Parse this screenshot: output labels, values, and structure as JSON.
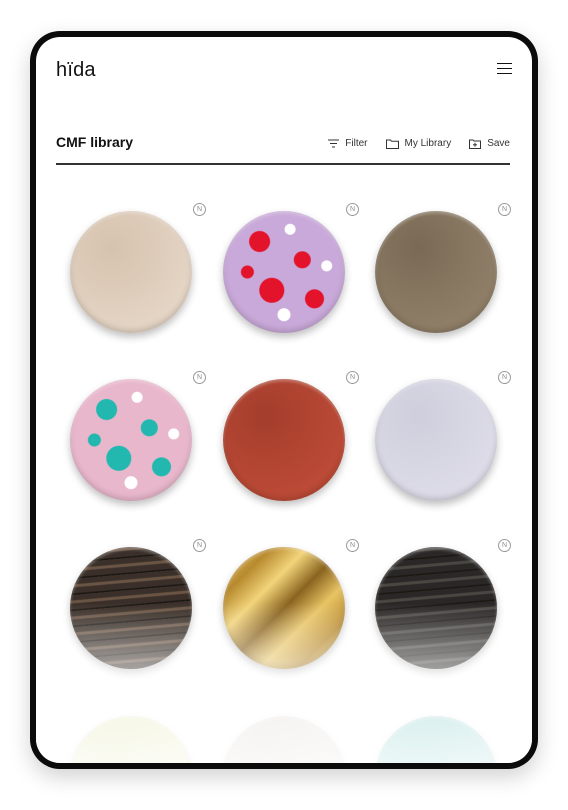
{
  "header": {
    "logo": "hïda"
  },
  "page": {
    "title": "CMF library"
  },
  "toolbar": {
    "filter_label": "Filter",
    "library_label": "My Library",
    "save_label": "Save"
  },
  "badge_glyph": "N",
  "materials": [
    {
      "name": "beige-textured",
      "color": "#e4d4c4",
      "color2": "#d6c2ae",
      "pattern": "plain"
    },
    {
      "name": "lilac-red-terrazzo",
      "color": "#c9a9d9",
      "color2": "#e4132c",
      "pattern": "terrazzo"
    },
    {
      "name": "taupe-matte",
      "color": "#8f7e67",
      "color2": "#7a6a55",
      "pattern": "plain"
    },
    {
      "name": "pink-teal-terrazzo",
      "color": "#e9b7cc",
      "color2": "#22b8b0",
      "pattern": "terrazzo"
    },
    {
      "name": "terracotta",
      "color": "#bb4a36",
      "color2": "#a43d2c",
      "pattern": "plain"
    },
    {
      "name": "pale-lavender-stone",
      "color": "#dcdbe7",
      "color2": "#cfcedc",
      "pattern": "plain"
    },
    {
      "name": "dark-wood",
      "color": "#3b3029",
      "color2": "#6a5444",
      "pattern": "wood"
    },
    {
      "name": "gold-foil",
      "color": "#b88a2e",
      "color2": "#e8c464",
      "pattern": "foil"
    },
    {
      "name": "black-wood",
      "color": "#2a2826",
      "color2": "#4a4743",
      "pattern": "wood"
    },
    {
      "name": "pale-yellow",
      "color": "#e9ebb8",
      "color2": "#dfe2a8",
      "pattern": "plain"
    },
    {
      "name": "off-white",
      "color": "#e6e0da",
      "color2": "#dcd4cc",
      "pattern": "plain"
    },
    {
      "name": "aqua",
      "color": "#8fd3d0",
      "color2": "#7bc8c6",
      "pattern": "plain"
    }
  ]
}
